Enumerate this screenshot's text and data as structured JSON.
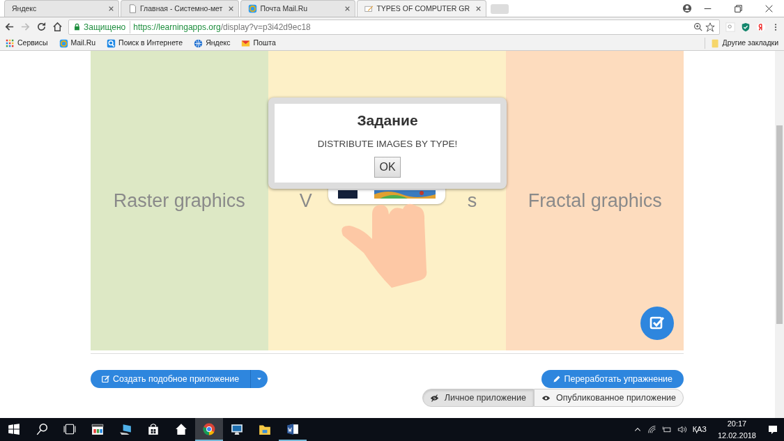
{
  "browser": {
    "tabs": [
      {
        "title": "Яндекс",
        "kind": "plain",
        "selected": false
      },
      {
        "title": "Главная - Системно-мет",
        "kind": "page",
        "selected": false
      },
      {
        "title": "Почта Mail.Ru",
        "kind": "mail",
        "selected": false
      },
      {
        "title": "TYPES OF COMPUTER GR",
        "kind": "edit",
        "selected": true
      }
    ],
    "address": {
      "secure_label": "Защищено",
      "url_host": "https://learningapps.org",
      "url_path": "/display?v=p3i42d9ec18"
    },
    "bookmarks": [
      {
        "label": "Сервисы",
        "kind": "apps"
      },
      {
        "label": "Mail.Ru",
        "kind": "mail"
      },
      {
        "label": "Поиск в Интернете",
        "kind": "search"
      },
      {
        "label": "Яндекс",
        "kind": "globe"
      },
      {
        "label": "Пошта",
        "kind": "envelope"
      }
    ],
    "other_bookmarks": "Другие закладки"
  },
  "exercise": {
    "columns": [
      {
        "label": "Raster graphics",
        "color": "#dde8c5"
      },
      {
        "label_parts": [
          "V",
          "s"
        ],
        "color": "#fdf0c7"
      },
      {
        "label": "Fractal graphics",
        "color": "#fddcbe"
      }
    ]
  },
  "dialog": {
    "title": "Задание",
    "message": "DISTRIBUTE IMAGES BY TYPE!",
    "button": "OK"
  },
  "actions": {
    "create": "Создать подобное приложение",
    "rework": "Переработать упражнение",
    "visibility": [
      {
        "label": "Личное приложение",
        "selected": true
      },
      {
        "label": "Опубликованное приложение",
        "selected": false
      }
    ]
  },
  "taskbar": {
    "apps": [
      {
        "kind": "start",
        "active": false,
        "running": false
      },
      {
        "kind": "search",
        "active": false,
        "running": false
      },
      {
        "kind": "taskview",
        "active": false,
        "running": false
      },
      {
        "kind": "player",
        "active": false,
        "running": false
      },
      {
        "kind": "computer",
        "active": false,
        "running": false
      },
      {
        "kind": "store",
        "active": false,
        "running": false
      },
      {
        "kind": "home",
        "active": false,
        "running": false
      },
      {
        "kind": "chrome",
        "active": true,
        "running": true
      },
      {
        "kind": "monitor",
        "active": false,
        "running": false
      },
      {
        "kind": "folder",
        "active": false,
        "running": false
      },
      {
        "kind": "word",
        "active": false,
        "running": true
      }
    ],
    "language": "ҚАЗ",
    "time": "20:17",
    "date": "12.02.2018"
  }
}
